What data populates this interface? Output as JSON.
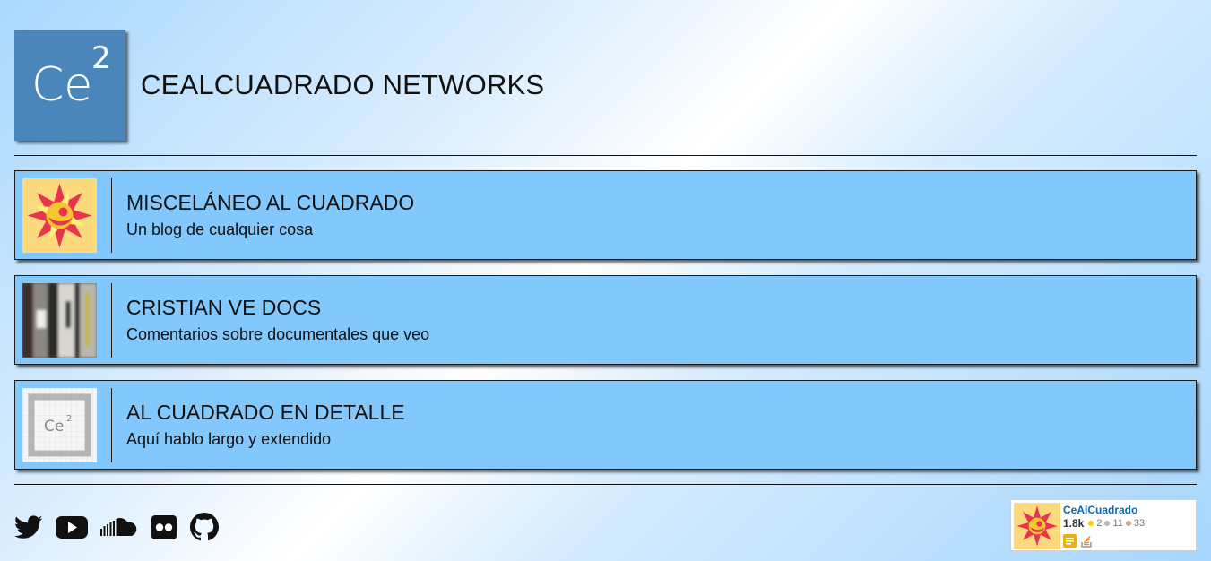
{
  "header": {
    "logo_text": "Ce",
    "logo_superscript": "2",
    "title": "CEALCUADRADO NETWORKS"
  },
  "cards": [
    {
      "title": "MISCELÁNEO AL CUADRADO",
      "subtitle": "Un blog de cualquier cosa",
      "icon": "sun-emblem-icon"
    },
    {
      "title": "CRISTIAN VE DOCS",
      "subtitle": "Comentarios sobre documentales que veo",
      "icon": "blurred-docs-photo-thumbnail"
    },
    {
      "title": "AL CUADRADO EN DETALLE",
      "subtitle": "Aquí hablo largo y extendido",
      "icon": "sketched-ce2-logo-thumbnail"
    }
  ],
  "social_icons": [
    "twitter-icon",
    "youtube-icon",
    "soundcloud-icon",
    "flickr-icon",
    "github-icon"
  ],
  "profile_badge": {
    "name": "CeAlCuadrado",
    "reputation": "1.8k",
    "gold": "2",
    "silver": "11",
    "bronze": "33",
    "site_icons": [
      "meta-stackexchange-icon",
      "stackoverflow-icon"
    ]
  },
  "colors": {
    "card_bg": "#83c8fd",
    "logo_bg": "#4a86ba",
    "badge_name": "#0a6ab0",
    "gold": "#ffcc01",
    "silver": "#b4b8bc",
    "bronze": "#d1a684"
  }
}
